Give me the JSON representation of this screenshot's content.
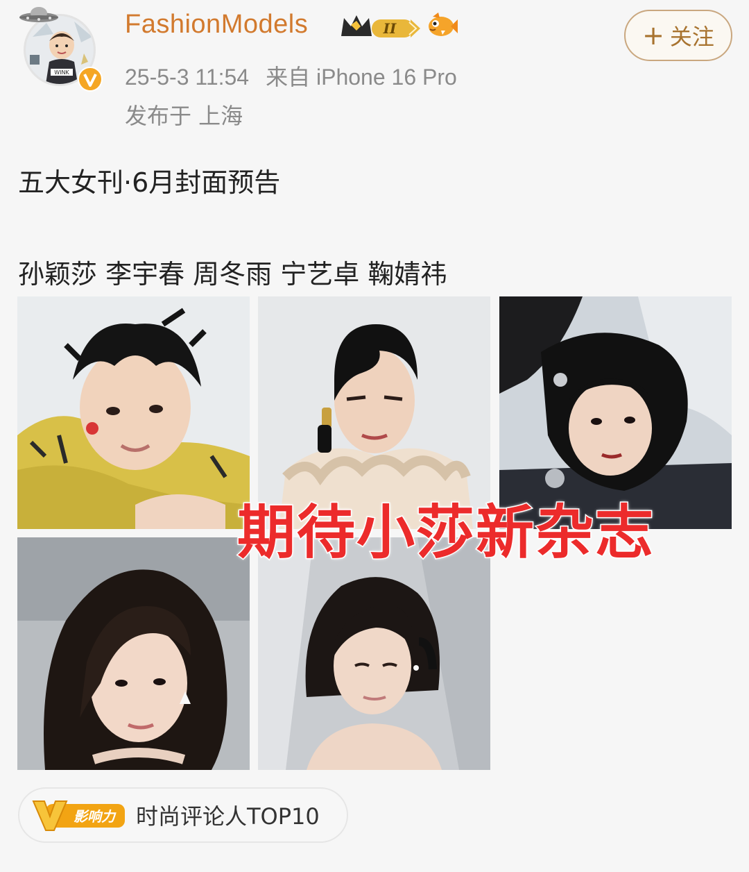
{
  "author": {
    "name": "FashionModels",
    "level_badge": "II",
    "timestamp": "25-5-3 11:54",
    "source": "来自 iPhone 16 Pro",
    "location": "发布于 上海",
    "avatar_label": "WINK"
  },
  "follow_button": {
    "plus": "+",
    "label": "关注"
  },
  "post": {
    "title": "五大女刊·6月封面预告",
    "names": "孙颖莎 李宇春 周冬雨 宁艺卓 鞠婧祎"
  },
  "overlay_caption": "期待小莎新杂志",
  "influence_badge": {
    "icon_text": "影响力",
    "label": "时尚评论人TOP10"
  },
  "colors": {
    "username": "#d27a2e",
    "caption": "#ec2b2b",
    "follow_border": "#c9a77f",
    "badge_gold": "#f2a413"
  }
}
